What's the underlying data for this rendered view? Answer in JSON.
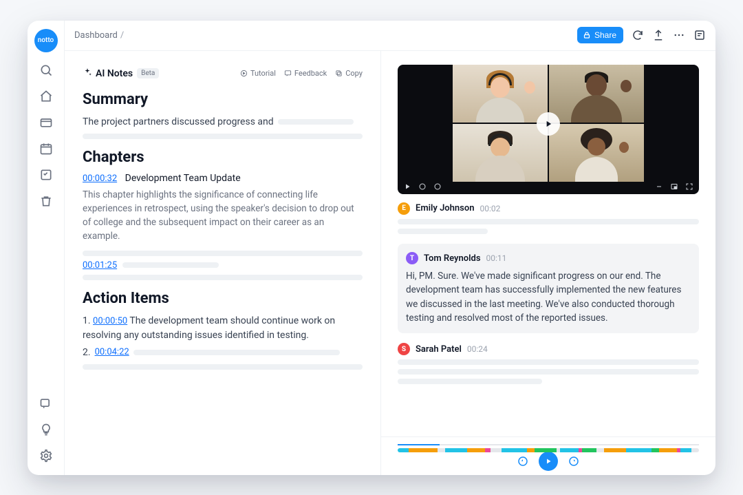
{
  "brand": "notto",
  "breadcrumb": "Dashboard",
  "topbar": {
    "share_label": "Share"
  },
  "notes": {
    "title": "AI Notes",
    "badge": "Beta",
    "links": {
      "tutorial": "Tutorial",
      "feedback": "Feedback",
      "copy": "Copy"
    },
    "summary_heading": "Summary",
    "summary_text": "The  project partners discussed progress and",
    "chapters_heading": "Chapters",
    "chapters": [
      {
        "ts": "00:00:32",
        "title": "Development Team Update",
        "desc": "This chapter highlights the significance of connecting life experiences in retrospect, using the speaker's decision to drop out of college and the subsequent impact on their career as an example."
      },
      {
        "ts": "00:01:25",
        "title": "",
        "desc": ""
      }
    ],
    "action_heading": "Action Items",
    "action_items": [
      {
        "n": "1.",
        "ts": "00:00:50",
        "text": "The development team should continue work on resolving any outstanding issues identified in testing."
      },
      {
        "n": "2.",
        "ts": "00:04:22",
        "text": ""
      }
    ]
  },
  "transcript": [
    {
      "initial": "E",
      "color": "#f59e0b",
      "name": "Emily Johnson",
      "ts": "00:02",
      "text": "",
      "active": false
    },
    {
      "initial": "T",
      "color": "#8b5cf6",
      "name": "Tom Reynolds",
      "ts": "00:11",
      "text": "Hi, PM. Sure. We've made significant progress on our end. The development team has successfully implemented the new features we discussed in the last meeting. We've also conducted thorough testing and resolved most of the reported issues.",
      "active": true
    },
    {
      "initial": "S",
      "color": "#ef4444",
      "name": "Sarah Patel",
      "ts": "00:24",
      "text": "",
      "active": false
    }
  ],
  "segments": [
    {
      "c": "#22c3e6",
      "w": 3
    },
    {
      "c": "#f59e0b",
      "w": 8
    },
    {
      "c": "#e5e7eb",
      "w": 2
    },
    {
      "c": "#22c3e6",
      "w": 6
    },
    {
      "c": "#f59e0b",
      "w": 5
    },
    {
      "c": "#ec4899",
      "w": 1.5
    },
    {
      "c": "#e5e7eb",
      "w": 3
    },
    {
      "c": "#22c3e6",
      "w": 7
    },
    {
      "c": "#f59e0b",
      "w": 2
    },
    {
      "c": "#22c55e",
      "w": 6
    },
    {
      "c": "#e5e7eb",
      "w": 1
    },
    {
      "c": "#22c3e6",
      "w": 5
    },
    {
      "c": "#ec4899",
      "w": 1
    },
    {
      "c": "#22c55e",
      "w": 4
    },
    {
      "c": "#e5e7eb",
      "w": 2
    },
    {
      "c": "#f59e0b",
      "w": 6
    },
    {
      "c": "#22c3e6",
      "w": 7
    },
    {
      "c": "#22c55e",
      "w": 2
    },
    {
      "c": "#f59e0b",
      "w": 5
    },
    {
      "c": "#ec4899",
      "w": 1
    },
    {
      "c": "#22c3e6",
      "w": 3
    },
    {
      "c": "#e5e7eb",
      "w": 2
    }
  ]
}
